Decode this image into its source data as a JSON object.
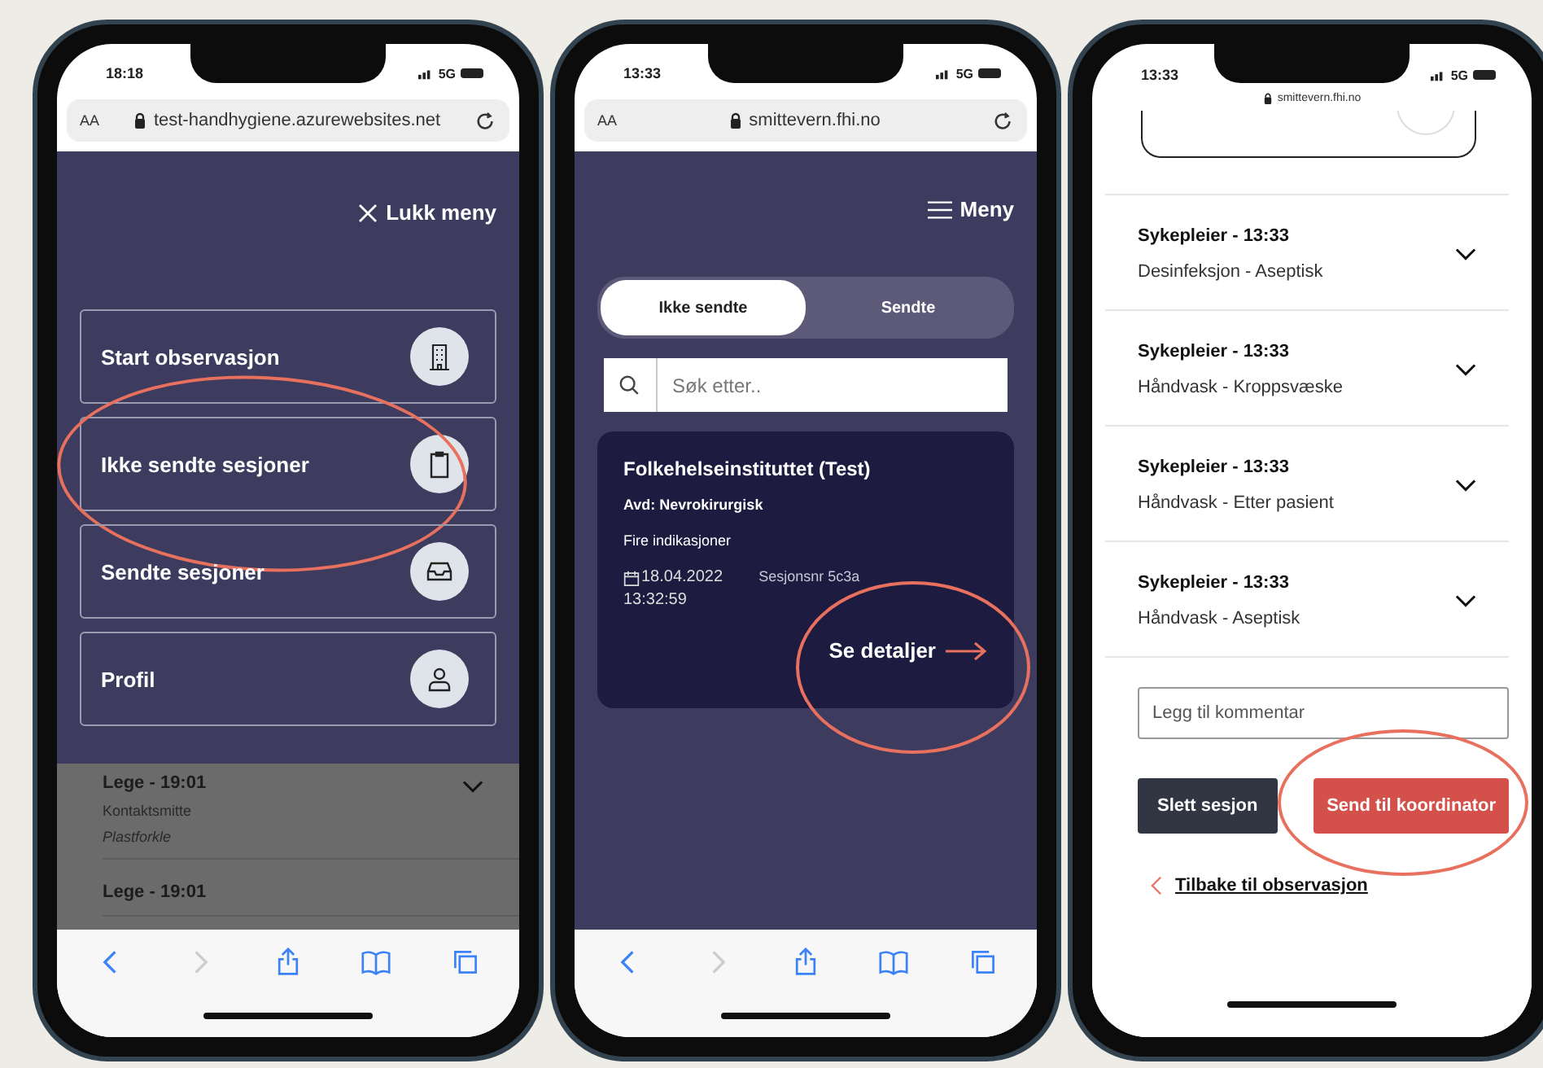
{
  "menu_screen": {
    "status": {
      "time": "18:18",
      "network": "5G"
    },
    "browser": {
      "text_size": "AA",
      "url": "test-handhygiene.azurewebsites.net"
    },
    "menu_toggle": "Lukk meny",
    "menu_items": [
      {
        "label": "Start observasjon",
        "highlighted": false
      },
      {
        "label": "Ikke sendte sesjoner",
        "highlighted": true
      },
      {
        "label": "Sendte sesjoner",
        "highlighted": false
      },
      {
        "label": "Profil",
        "highlighted": false
      }
    ],
    "background_list": [
      {
        "title": "Lege - 19:01",
        "type": "Kontaktsmitte",
        "detail": "Plastforkle"
      },
      {
        "title": "Lege - 19:01"
      }
    ],
    "toolbar": [
      {
        "disabled": false
      },
      {
        "disabled": true
      },
      {
        "disabled": false
      },
      {
        "disabled": false
      },
      {
        "disabled": false
      }
    ]
  },
  "sessions_screen": {
    "status": {
      "time": "13:33",
      "network": "5G"
    },
    "browser": {
      "text_size": "AA",
      "url": "smittevern.fhi.no"
    },
    "menu_toggle": "Meny",
    "tabs": [
      {
        "label": "Ikke sendte",
        "selected": true
      },
      {
        "label": "Sendte",
        "selected": false
      }
    ],
    "search": {
      "placeholder": "Søk etter.."
    },
    "card": {
      "title": "Folkehelseinstituttet (Test)",
      "department": "Avd: Nevrokirurgisk",
      "indications": "Fire indikasjoner",
      "date": "18.04.2022",
      "time": "13:32:59",
      "session": "Sesjonsnr 5c3a",
      "link": "Se detaljer",
      "highlighted": true
    },
    "toolbar": [
      {
        "disabled": false
      },
      {
        "disabled": true
      },
      {
        "disabled": false
      },
      {
        "disabled": false
      },
      {
        "disabled": false
      }
    ]
  },
  "detail_screen": {
    "status": {
      "time": "13:33",
      "network": "5G"
    },
    "url": "smittevern.fhi.no",
    "observations": [
      {
        "title": "Sykepleier - 13:33",
        "subtitle": "Desinfeksjon - Aseptisk",
        "expanded": false
      },
      {
        "title": "Sykepleier - 13:33",
        "subtitle": "Håndvask - Kroppsvæske",
        "expanded": false
      },
      {
        "title": "Sykepleier - 13:33",
        "subtitle": "Håndvask - Etter pasient",
        "expanded": false
      },
      {
        "title": "Sykepleier - 13:33",
        "subtitle": "Håndvask - Aseptisk",
        "expanded": false
      }
    ],
    "comment": {
      "placeholder": "Legg til kommentar"
    },
    "delete_button": "Slett sesjon",
    "send_button": {
      "label": "Send til koordinator",
      "highlighted": true
    },
    "back_link": "Tilbake til observasjon"
  }
}
